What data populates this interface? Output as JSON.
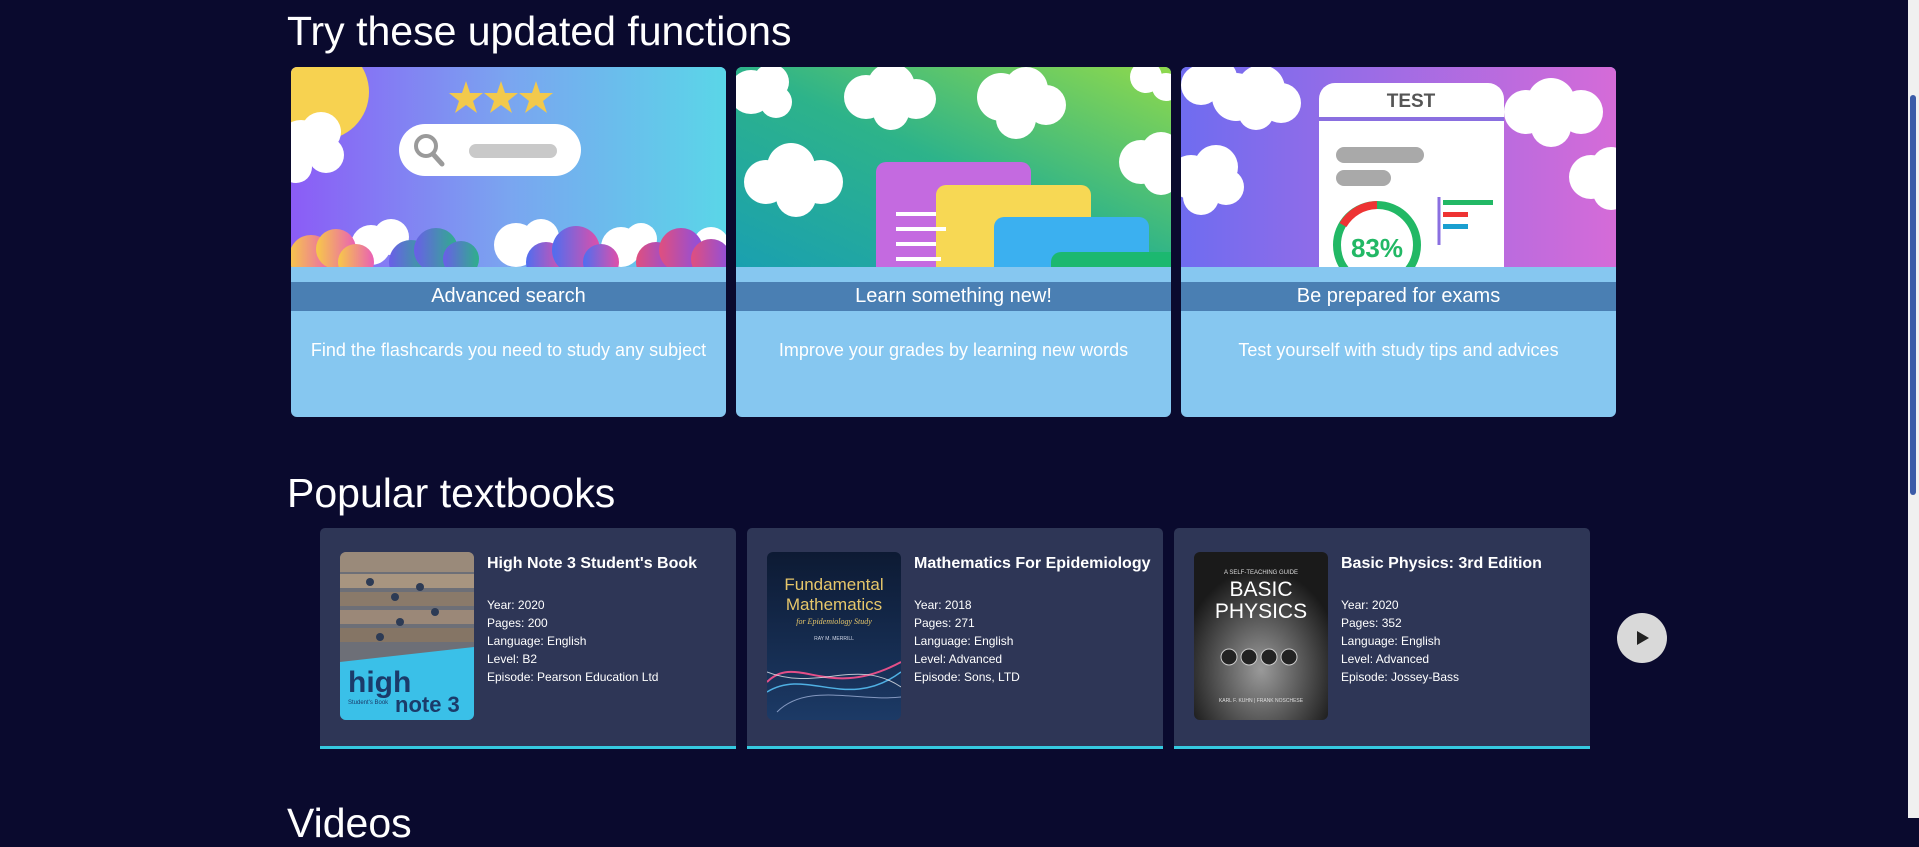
{
  "sections": {
    "features_title": "Try these updated functions",
    "textbooks_title": "Popular textbooks",
    "videos_title": "Videos"
  },
  "features": [
    {
      "title": "Advanced search",
      "description": "Find the flashcards you need to study any subject",
      "icon": "search-illustration"
    },
    {
      "title": "Learn something new!",
      "description": "Improve your grades by learning new words",
      "icon": "flashcards-illustration"
    },
    {
      "title": "Be prepared for exams",
      "description": "Test yourself with study tips and advices",
      "icon": "test-illustration"
    }
  ],
  "feature_illustrations": {
    "test_label": "TEST",
    "test_score": "83%"
  },
  "textbooks": [
    {
      "title": "High Note 3 Student's Book",
      "year": "Year: 2020",
      "pages": "Pages: 200",
      "language": "Language: English",
      "level": "Level: B2",
      "episode": "Episode: Pearson Education Ltd",
      "cover": {
        "main": "high",
        "sub": "note 3",
        "caption": "Student's Book"
      }
    },
    {
      "title": "Mathematics For Epidemiology",
      "year": "Year: 2018",
      "pages": "Pages: 271",
      "language": "Language: English",
      "level": "Level: Advanced",
      "episode": "Episode: Sons, LTD",
      "cover": {
        "line1": "Fundamental",
        "line2": "Mathematics",
        "line3": "for Epidemiology Study",
        "author": "RAY M. MERRILL"
      }
    },
    {
      "title": "Basic Physics: 3rd Edition",
      "year": "Year: 2020",
      "pages": "Pages: 352",
      "language": "Language: English",
      "level": "Level: Advanced",
      "episode": "Episode: Jossey-Bass",
      "cover": {
        "tagline": "A SELF-TEACHING GUIDE",
        "line1": "BASIC",
        "line2": "PHYSICS",
        "authors": "KARL F. KUHN  |  FRANK NOSCHESE"
      }
    }
  ],
  "colors": {
    "background": "#0a0a2e",
    "feature_card": "#86c7f0",
    "feature_band": "#4a7fb3",
    "book_card": "#2e3656",
    "book_accent": "#35c9e0"
  },
  "icons": {
    "next": "play-arrow-icon",
    "stars": "star-icon",
    "search": "magnifier-icon"
  }
}
